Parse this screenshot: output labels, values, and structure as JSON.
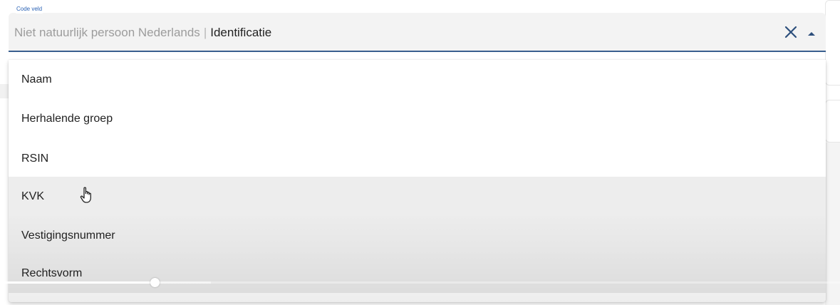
{
  "field": {
    "label": "Code veld",
    "parent_value": "Niet natuurlijk persoon Nederlands",
    "separator": "|",
    "selected_value": "Identificatie",
    "clear_icon": "close-icon",
    "toggle_icon": "caret-up-icon"
  },
  "dropdown": {
    "items": [
      {
        "label": "Naam"
      },
      {
        "label": "Herhalende groep"
      },
      {
        "label": "RSIN"
      },
      {
        "label": "KVK"
      },
      {
        "label": "Vestigingsnummer"
      },
      {
        "label": "Rechtsvorm"
      }
    ]
  },
  "video_progress": {
    "played_fraction": 0.184,
    "buffered_fraction": 0.251
  },
  "colors": {
    "accent": "#3a5f8f",
    "label": "#2a62b5",
    "clear_icon": "#2d4f7c"
  }
}
